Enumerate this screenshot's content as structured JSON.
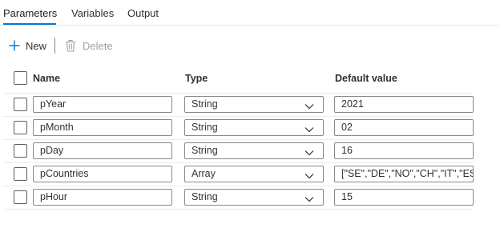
{
  "tabs": [
    {
      "label": "Parameters",
      "active": true
    },
    {
      "label": "Variables",
      "active": false
    },
    {
      "label": "Output",
      "active": false
    }
  ],
  "toolbar": {
    "new_label": "New",
    "new_icon": "plus-icon",
    "delete_label": "Delete",
    "delete_icon": "trash-icon",
    "delete_disabled": true
  },
  "table": {
    "headers": {
      "name": "Name",
      "type": "Type",
      "default": "Default value"
    },
    "rows": [
      {
        "name": "pYear",
        "type": "String",
        "default": "2021"
      },
      {
        "name": "pMonth",
        "type": "String",
        "default": "02"
      },
      {
        "name": "pDay",
        "type": "String",
        "default": "16"
      },
      {
        "name": "pCountries",
        "type": "Array",
        "default": "[\"SE\",\"DE\",\"NO\",\"CH\",\"IT\",\"ES\","
      },
      {
        "name": "pHour",
        "type": "String",
        "default": "15"
      }
    ]
  },
  "colors": {
    "accent": "#0078d4",
    "border": "#8a8886",
    "divider": "#edebe9",
    "disabled": "#a19f9d"
  }
}
